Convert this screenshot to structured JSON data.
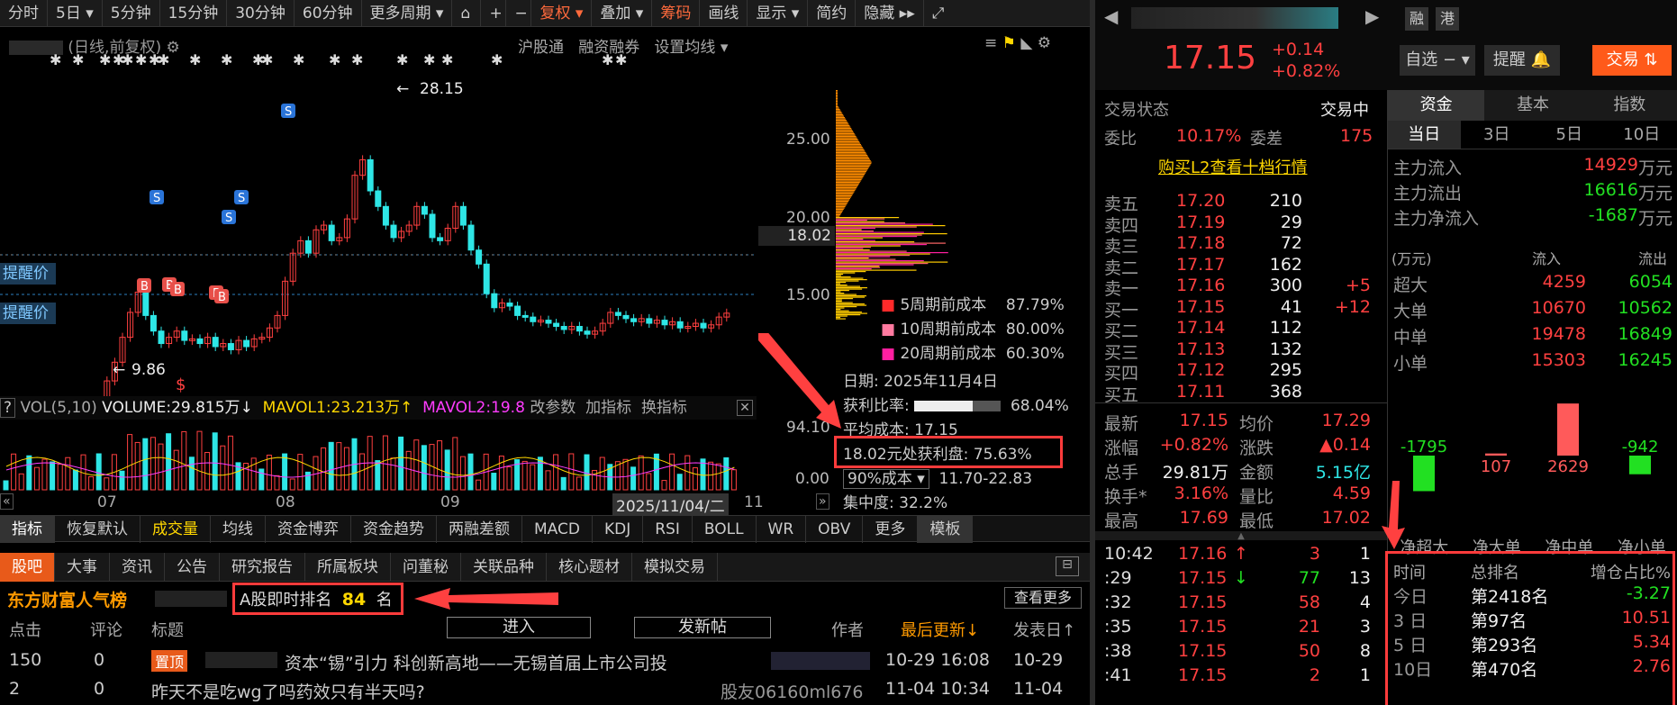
{
  "toolbar": {
    "items": [
      "分时",
      "5日",
      "5分钟",
      "15分钟",
      "30分钟",
      "60分钟",
      "更多周期",
      "复权",
      "叠加",
      "筹码",
      "画线",
      "显示",
      "简约",
      "隐藏"
    ]
  },
  "chart_header": {
    "mode": "(日线,前复权)",
    "links": [
      "沪股通",
      "融资融券",
      "设置均线"
    ]
  },
  "price_axis": [
    "25.00",
    "20.00",
    "15.00"
  ],
  "current_price_tag": "18.02",
  "annotations": {
    "high": "28.15",
    "low": "9.86",
    "alert1": "提醒价",
    "alert2": "提醒价",
    "s": "S",
    "b": "B"
  },
  "volume_header": {
    "label": "VOL(5,10)",
    "volume": "VOLUME:29.815万",
    "mavol1": "MAVOL1:23.213万",
    "mavol2": "MAVOL2:19.8",
    "btns": [
      "改参数",
      "加指标",
      "换指标"
    ]
  },
  "volume_axis": [
    "94.10",
    "0.00"
  ],
  "date_axis": [
    "07",
    "08",
    "09",
    "11"
  ],
  "date_box": "2025/11/04/二",
  "indicator_tabs": [
    "指标",
    "恢复默认",
    "成交量",
    "均线",
    "资金博弈",
    "资金趋势",
    "两融差额",
    "MACD",
    "KDJ",
    "RSI",
    "BOLL",
    "WR",
    "OBV",
    "更多",
    "模板"
  ],
  "chip": {
    "rows": [
      {
        "label": "5周期前成本",
        "value": "87.79%",
        "color": "#ff2a2a"
      },
      {
        "label": "10周期前成本",
        "value": "80.00%",
        "color": "#ff7aa0"
      },
      {
        "label": "20周期前成本",
        "value": "60.30%",
        "color": "#ff1fa0"
      }
    ],
    "date": "日期: 2025年11月4日",
    "profit_ratio_label": "获利比率:",
    "profit_ratio": "68.04%",
    "profit_ratio_fraction": 0.68,
    "avg_cost": "平均成本: 17.15",
    "profit_at": "18.02元处获利盘: 75.63%",
    "cost90": "90%成本",
    "cost90_range": "11.70-22.83",
    "concentration": "集中度: 32.2%"
  },
  "stock": {
    "price": "17.15",
    "change": "+0.14",
    "change_pct": "+0.82%",
    "badges": [
      "融",
      "港"
    ],
    "btn_watch": "自选",
    "btn_remind": "提醒",
    "btn_trade": "交易"
  },
  "trade_status": {
    "label": "交易状态",
    "value": "交易中",
    "wb_label": "委比",
    "wb": "10.17%",
    "wc_label": "委差",
    "wc": "175",
    "l2": "购买L2查看十档行情"
  },
  "asks": [
    {
      "name": "卖五",
      "price": "17.20",
      "vol": "210",
      "chg": ""
    },
    {
      "name": "卖四",
      "price": "17.19",
      "vol": "29",
      "chg": ""
    },
    {
      "name": "卖三",
      "price": "17.18",
      "vol": "72",
      "chg": ""
    },
    {
      "name": "卖二",
      "price": "17.17",
      "vol": "162",
      "chg": ""
    },
    {
      "name": "卖一",
      "price": "17.16",
      "vol": "300",
      "chg": "+5"
    }
  ],
  "bids": [
    {
      "name": "买一",
      "price": "17.15",
      "vol": "41",
      "chg": "+12"
    },
    {
      "name": "买二",
      "price": "17.14",
      "vol": "112",
      "chg": ""
    },
    {
      "name": "买三",
      "price": "17.13",
      "vol": "132",
      "chg": ""
    },
    {
      "name": "买四",
      "price": "17.12",
      "vol": "295",
      "chg": ""
    },
    {
      "name": "买五",
      "price": "17.11",
      "vol": "368",
      "chg": ""
    }
  ],
  "stats": [
    [
      "最新",
      "17.15",
      "均价",
      "17.29"
    ],
    [
      "涨幅",
      "+0.82%",
      "涨跌",
      "▲0.14"
    ],
    [
      "总手",
      "29.81万",
      "金额",
      "5.15亿"
    ],
    [
      "换手*",
      "3.16%",
      "量比",
      "4.59"
    ],
    [
      "最高",
      "17.69",
      "最低",
      "17.02"
    ]
  ],
  "ticks": [
    {
      "t": "10:42",
      "p": "17.16",
      "arrow": "↑",
      "v": "3",
      "n": "1"
    },
    {
      "t": ":29",
      "p": "17.15",
      "arrow": "↓",
      "v": "77",
      "n": "13"
    },
    {
      "t": ":32",
      "p": "17.15",
      "arrow": "",
      "v": "58",
      "n": "4"
    },
    {
      "t": ":35",
      "p": "17.15",
      "arrow": "",
      "v": "21",
      "n": "3"
    },
    {
      "t": ":38",
      "p": "17.15",
      "arrow": "",
      "v": "50",
      "n": "8"
    },
    {
      "t": ":41",
      "p": "17.15",
      "arrow": "",
      "v": "2",
      "n": "1"
    }
  ],
  "fund_tabs": [
    "资金",
    "基本",
    "指数"
  ],
  "period_tabs": [
    "当日",
    "3日",
    "5日",
    "10日"
  ],
  "flows": [
    {
      "label": "主力流入",
      "value": "14929",
      "unit": "万元"
    },
    {
      "label": "主力流出",
      "value": "16616",
      "unit": "万元"
    },
    {
      "label": "主力净流入",
      "value": "-1687",
      "unit": "万元"
    }
  ],
  "flow_table": {
    "head": [
      "(万元)",
      "流入",
      "流出"
    ],
    "rows": [
      [
        "超大",
        "4259",
        "6054"
      ],
      [
        "大单",
        "10670",
        "10562"
      ],
      [
        "中单",
        "19478",
        "16849"
      ],
      [
        "小单",
        "15303",
        "16245"
      ]
    ]
  },
  "net_bars": {
    "values": [
      -1795,
      107,
      2629,
      -942
    ],
    "labels": [
      "-1795",
      "107",
      "2629",
      "-942"
    ],
    "axis": [
      "净超大",
      "净大单",
      "净中单",
      "净小单"
    ]
  },
  "rank_table": {
    "head": [
      "时间",
      "总排名",
      "增仓占比%"
    ],
    "rows": [
      [
        "今日",
        "第2418名",
        "-3.27"
      ],
      [
        "3 日",
        "第97名",
        "10.51"
      ],
      [
        "5 日",
        "第293名",
        "5.34"
      ],
      [
        "10日",
        "第470名",
        "2.76"
      ]
    ]
  },
  "forum_tabs": [
    "股吧",
    "大事",
    "资讯",
    "公告",
    "研究报告",
    "所属板块",
    "问董秘",
    "关联品种",
    "核心题材",
    "模拟交易"
  ],
  "popularity": {
    "title": "东方财富人气榜",
    "rank_label": "A股即时排名",
    "rank": "84",
    "rank_unit": "名",
    "more": "查看更多"
  },
  "post_head": {
    "clicks": "点击",
    "comments": "评论",
    "title": "标题",
    "enter": "进入",
    "post": "发新帖",
    "author": "作者",
    "updated": "最后更新↓",
    "posted": "发表日↑"
  },
  "posts": [
    {
      "clicks": "150",
      "comments": "0",
      "tag": "置顶",
      "title": "资本“锡”引力 科创新高地——无锡首届上市公司投",
      "updated": "10-29 16:08",
      "posted": "10-29"
    },
    {
      "clicks": "2",
      "comments": "0",
      "tag": "",
      "title": "昨天不是吃wg了吗药效只有半天吗?",
      "author": "股友06160ml676",
      "updated": "11-04 10:34",
      "posted": "11-04"
    }
  ]
}
